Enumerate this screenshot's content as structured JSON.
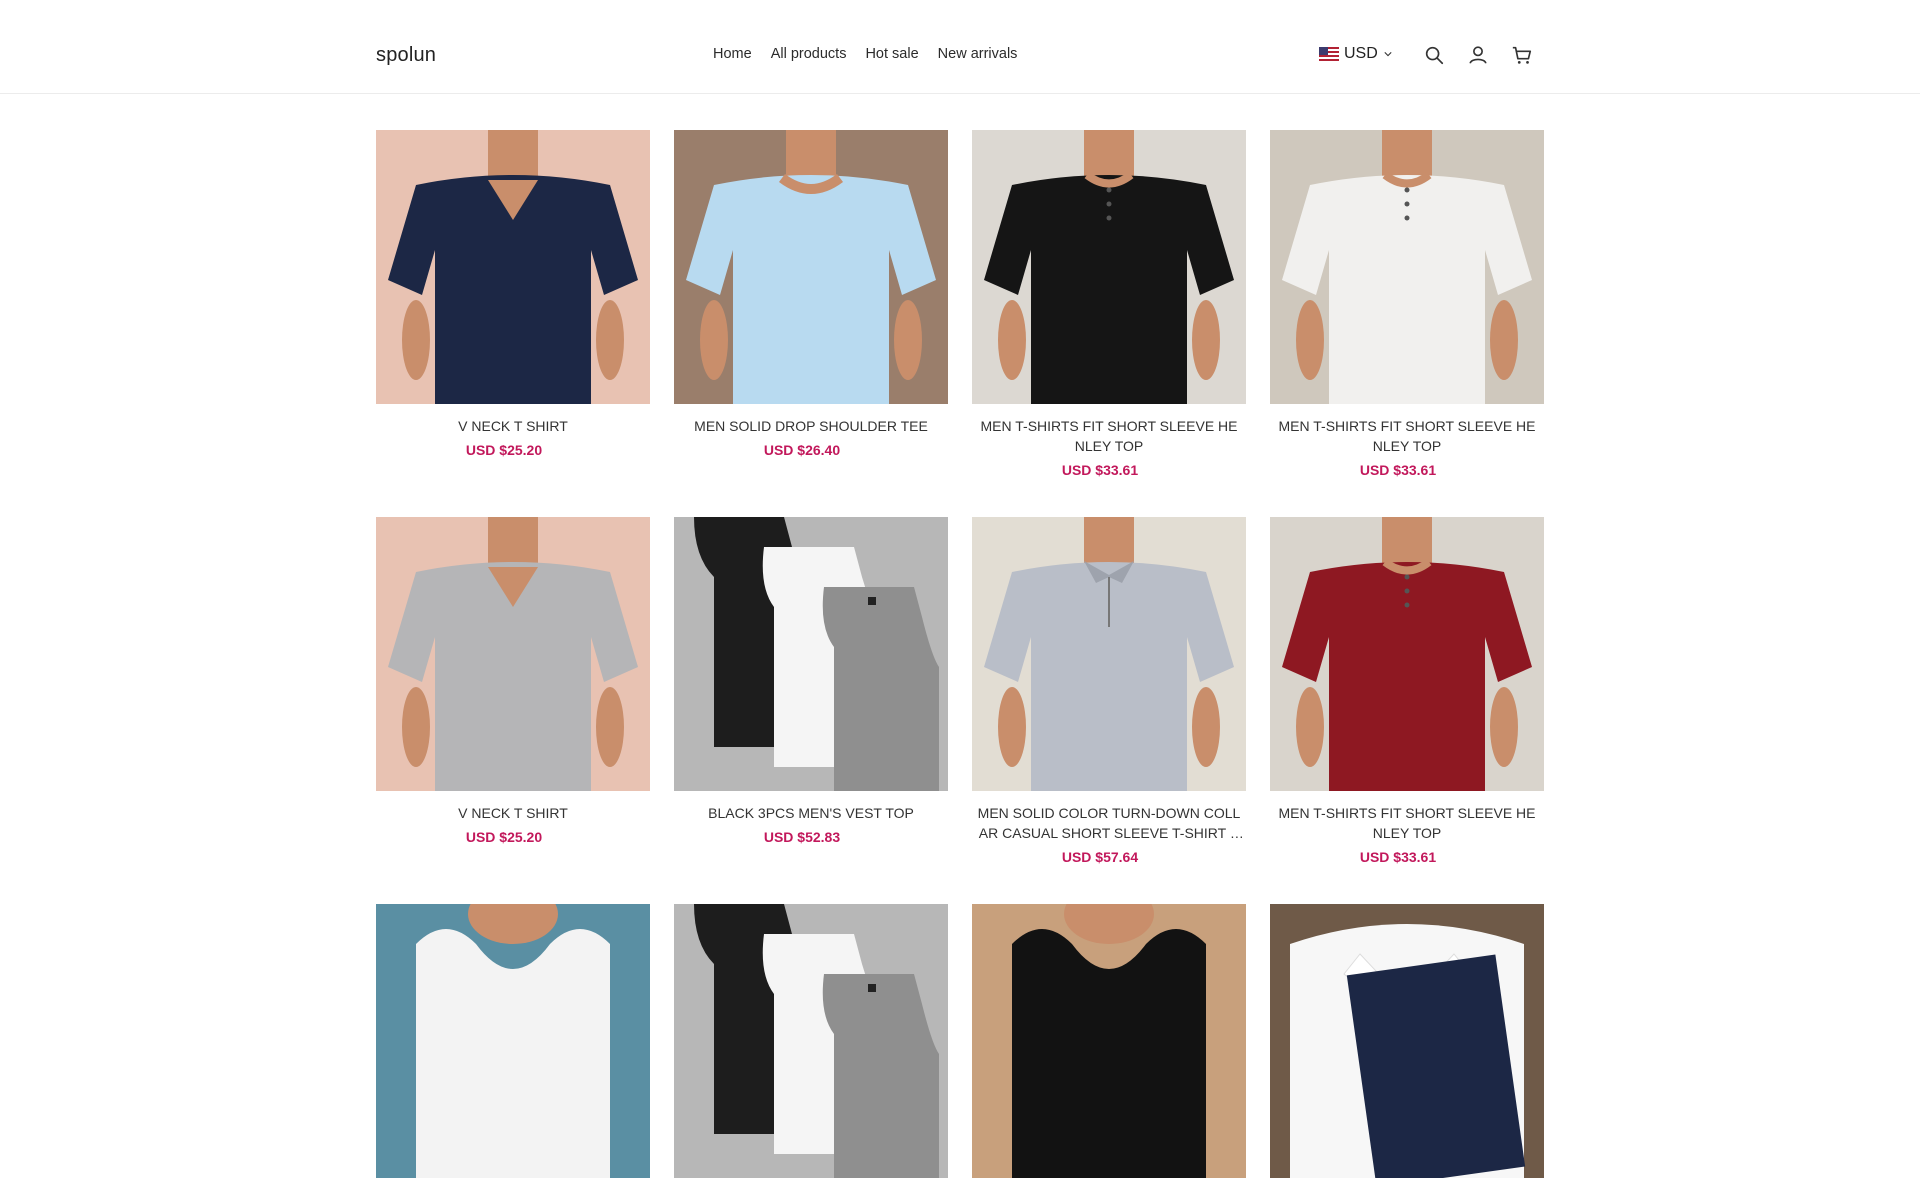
{
  "brand": "spolun",
  "nav": [
    "Home",
    "All products",
    "Hot sale",
    "New arrivals"
  ],
  "currency": {
    "code": "USD",
    "flag": "us-flag-icon"
  },
  "icons": {
    "search": "search-icon",
    "account": "user-icon",
    "cart": "cart-icon"
  },
  "colors": {
    "price": "#c2185b",
    "text": "#333333",
    "border": "#ececec"
  },
  "products": [
    {
      "title": "V NECK T SHIRT",
      "price": "USD $25.20",
      "bg": "#e8c2b2",
      "shirt": "#1c2745",
      "style": "vneck"
    },
    {
      "title": "MEN SOLID DROP SHOULDER TEE",
      "price": "USD $26.40",
      "bg": "#9a7e6b",
      "shirt": "#b8daf0",
      "style": "crew"
    },
    {
      "title": "MEN T-SHIRTS FIT SHORT SLEEVE HENLEY TOP",
      "price": "USD $33.61",
      "bg": "#dcd8d2",
      "shirt": "#151515",
      "style": "henley"
    },
    {
      "title": "MEN T-SHIRTS FIT SHORT SLEEVE HENLEY TOP",
      "price": "USD $33.61",
      "bg": "#cfc8bd",
      "shirt": "#f1f0ee",
      "style": "henley"
    },
    {
      "title": "V NECK T SHIRT",
      "price": "USD $25.20",
      "bg": "#e8c2b2",
      "shirt": "#b5b5b7",
      "style": "vneck"
    },
    {
      "title": "BLACK 3PCS MEN'S VEST TOP",
      "price": "USD $52.83",
      "bg": "#b7b7b7",
      "shirt": "#8f8f8f",
      "style": "vest3"
    },
    {
      "title": "MEN SOLID COLOR TURN-DOWN COLLAR CASUAL SHORT SLEEVE T-SHIRT SET",
      "price": "USD $57.64",
      "bg": "#e2ddd3",
      "shirt": "#b9bec8",
      "style": "polo"
    },
    {
      "title": "MEN T-SHIRTS FIT SHORT SLEEVE HENLEY TOP",
      "price": "USD $33.61",
      "bg": "#d9d4cc",
      "shirt": "#8e1822",
      "style": "henley"
    },
    {
      "title": "",
      "price": "",
      "bg": "#5a8fa3",
      "shirt": "#f3f3f3",
      "style": "tank"
    },
    {
      "title": "",
      "price": "",
      "bg": "#b7b7b7",
      "shirt": "#8f8f8f",
      "style": "vest3"
    },
    {
      "title": "",
      "price": "",
      "bg": "#c8a07c",
      "shirt": "#121212",
      "style": "tank"
    },
    {
      "title": "",
      "price": "",
      "bg": "#6f5a48",
      "shirt": "#f7f7f7",
      "style": "polo2"
    }
  ]
}
